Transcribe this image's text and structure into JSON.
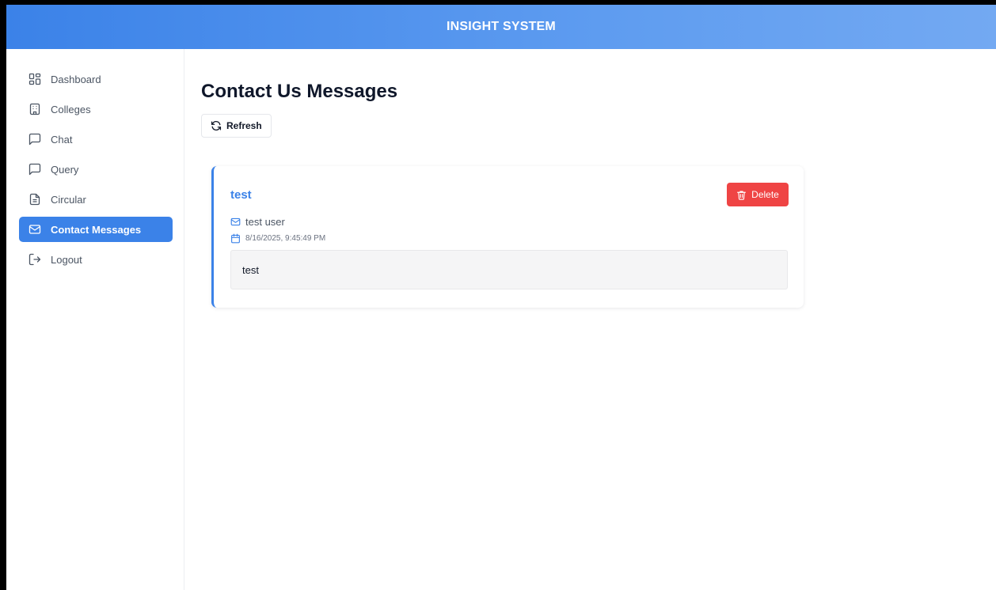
{
  "header": {
    "title": "INSIGHT SYSTEM"
  },
  "sidebar": {
    "items": [
      {
        "label": "Dashboard",
        "icon": "dashboard-grid-icon",
        "active": false
      },
      {
        "label": "Colleges",
        "icon": "building-icon",
        "active": false
      },
      {
        "label": "Chat",
        "icon": "message-square-icon",
        "active": false
      },
      {
        "label": "Query",
        "icon": "message-square-icon",
        "active": false
      },
      {
        "label": "Circular",
        "icon": "file-text-icon",
        "active": false
      },
      {
        "label": "Contact Messages",
        "icon": "mail-icon",
        "active": true
      },
      {
        "label": "Logout",
        "icon": "logout-icon",
        "active": false
      }
    ]
  },
  "main": {
    "title": "Contact Us Messages",
    "refresh_label": "Refresh",
    "messages": [
      {
        "subject": "test",
        "sender": "test user",
        "date": "8/16/2025, 9:45:49 PM",
        "body": "test",
        "delete_label": "Delete"
      }
    ]
  },
  "colors": {
    "accent": "#3b82e8",
    "danger": "#ef4444",
    "text": "#0f172a",
    "muted": "#4b5563"
  }
}
